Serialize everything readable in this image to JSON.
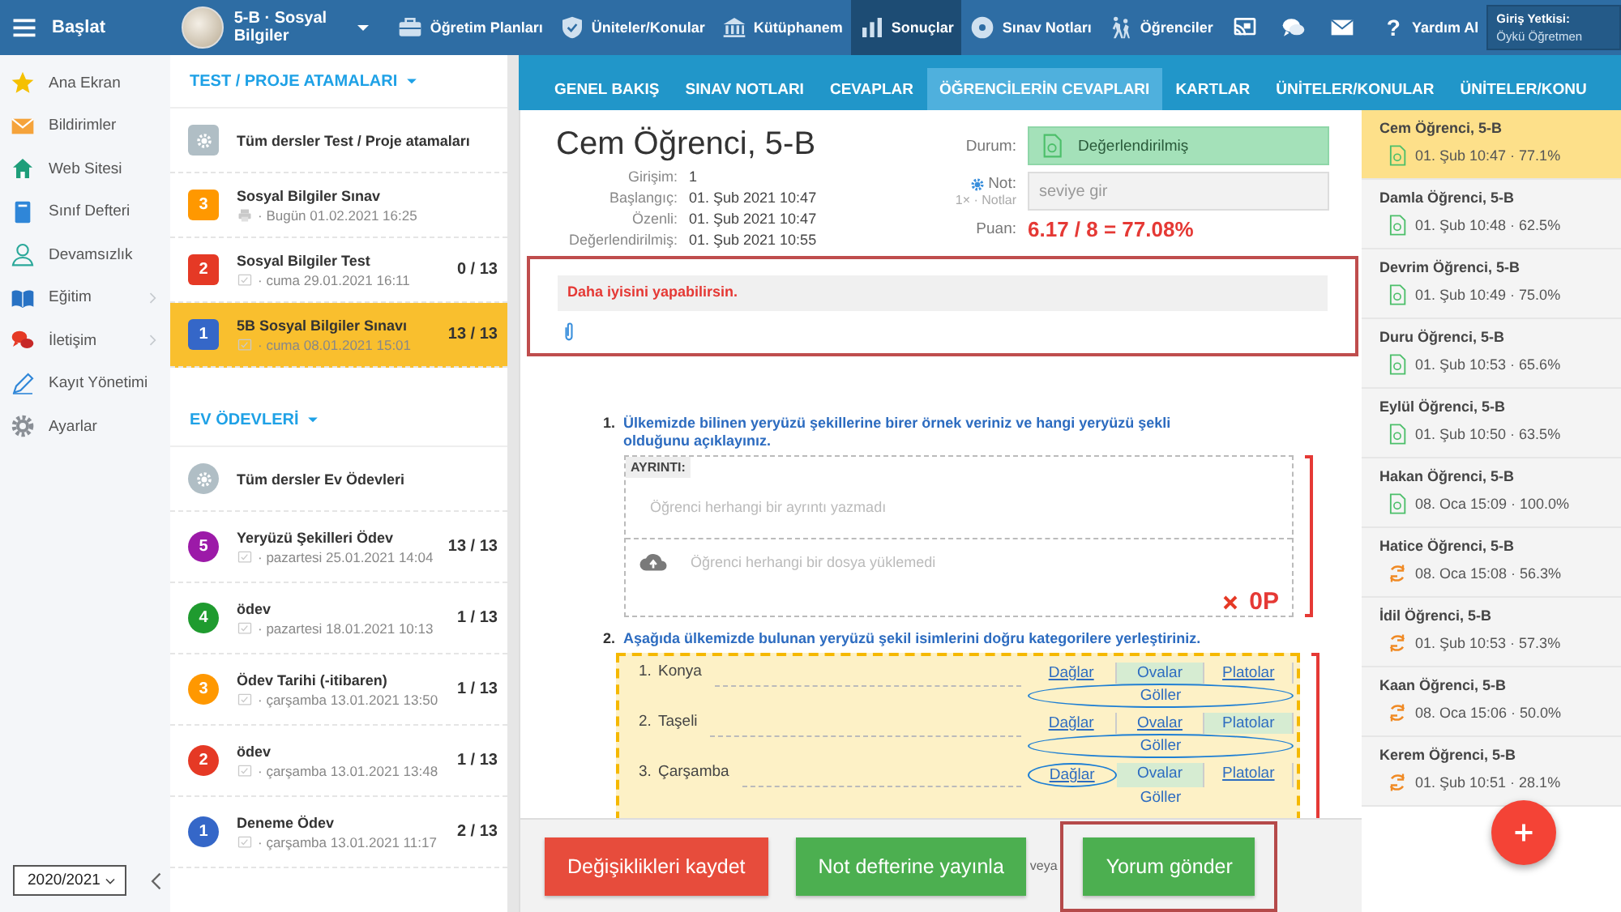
{
  "topbar": {
    "menu_label": "Başlat",
    "class_label": "5-B · Sosyal Bilgiler",
    "nav": [
      {
        "label": "Öğretim Planları",
        "kind": "briefcase",
        "selected": false
      },
      {
        "label": "Üniteler/Konular",
        "kind": "shield",
        "selected": false
      },
      {
        "label": "Kütüphanem",
        "kind": "bank",
        "selected": false
      },
      {
        "label": "Sonuçlar",
        "kind": "chart",
        "selected": true
      },
      {
        "label": "Sınav Notları",
        "kind": "disc",
        "selected": false
      },
      {
        "label": "Öğrenciler",
        "kind": "walkers",
        "selected": false
      }
    ],
    "help": {
      "glyph": "?",
      "label": "Yardım Al"
    },
    "login": {
      "label": "Giriş Yetkisi:",
      "user": "Öykü Öğretmen"
    }
  },
  "sidebar": {
    "items": [
      {
        "label": "Ana Ekran",
        "kind": "star",
        "expandable": false
      },
      {
        "label": "Bildirimler",
        "kind": "envelope",
        "expandable": false
      },
      {
        "label": "Web Sitesi",
        "kind": "house",
        "expandable": false
      },
      {
        "label": "Sınıf Defteri",
        "kind": "notebook",
        "expandable": false
      },
      {
        "label": "Devamsızlık",
        "kind": "person",
        "expandable": false
      },
      {
        "label": "Eğitim",
        "kind": "book",
        "expandable": true
      },
      {
        "label": "İletişim",
        "kind": "chat",
        "expandable": true
      },
      {
        "label": "Kayıt Yönetimi",
        "kind": "pen",
        "expandable": false
      },
      {
        "label": "Ayarlar",
        "kind": "gear",
        "expandable": false
      }
    ],
    "year": "2020/2021"
  },
  "assignments": {
    "sections": [
      {
        "title": "TEST / PROJE ATAMALARI",
        "kind": "square",
        "items": [
          {
            "kind": "all",
            "color": "#b0bec5",
            "title": "Tüm dersler Test / Proje atamaları",
            "selected": false
          },
          {
            "kind": "print",
            "badge": "3",
            "color": "#ff9800",
            "title": "Sosyal Bilgiler Sınav",
            "date": "· Bugün 01.02.2021 16:25",
            "selected": false
          },
          {
            "kind": "task",
            "badge": "2",
            "color": "#e53925",
            "title": "Sosyal Bilgiler Test",
            "date": "· cuma 29.01.2021 16:11",
            "count": "0 / 13",
            "selected": false
          },
          {
            "kind": "task",
            "badge": "1",
            "color": "#3567c8",
            "title": "5B Sosyal Bilgiler Sınavı",
            "date": "· cuma 08.01.2021 15:01",
            "count": "13 / 13",
            "selected": true
          }
        ]
      },
      {
        "title": "EV ÖDEVLERİ",
        "kind": "circle",
        "items": [
          {
            "kind": "all",
            "color": "#b0bec5",
            "title": "Tüm dersler Ev Ödevleri",
            "selected": false
          },
          {
            "kind": "task",
            "badge": "5",
            "color": "#9c1aa8",
            "title": "Yeryüzü Şekilleri Ödev",
            "date": "· pazartesi 25.01.2021 14:04",
            "count": "13 / 13",
            "selected": false
          },
          {
            "kind": "task",
            "badge": "4",
            "color": "#1f9b2f",
            "title": "ödev",
            "date": "· pazartesi 18.01.2021 10:13",
            "count": "1 / 13",
            "selected": false
          },
          {
            "kind": "task",
            "badge": "3",
            "color": "#ff9800",
            "title": "Ödev Tarihi (-itibaren)",
            "date": "· çarşamba 13.01.2021 13:50",
            "count": "1 / 13",
            "selected": false
          },
          {
            "kind": "task",
            "badge": "2",
            "color": "#e53925",
            "title": "ödev",
            "date": "· çarşamba 13.01.2021 13:48",
            "count": "1 / 13",
            "selected": false
          },
          {
            "kind": "task",
            "badge": "1",
            "color": "#3567c8",
            "title": "Deneme Ödev",
            "date": "· çarşamba 13.01.2021 11:17",
            "count": "2 / 13",
            "selected": false
          }
        ]
      }
    ]
  },
  "tabs": [
    {
      "label": "GENEL BAKIŞ",
      "selected": false
    },
    {
      "label": "SINAV NOTLARI",
      "selected": false
    },
    {
      "label": "CEVAPLAR",
      "selected": false
    },
    {
      "label": "ÖĞRENCİLERİN CEVAPLARI",
      "selected": true
    },
    {
      "label": "KARTLAR",
      "selected": false
    },
    {
      "label": "ÜNİTELER/KONULAR",
      "selected": false
    },
    {
      "label": "ÜNİTELER/KONU",
      "selected": false
    }
  ],
  "student": {
    "name": "Cem Öğrenci, 5-B",
    "info": [
      {
        "label": "Girişim:",
        "value": "1"
      },
      {
        "label": "Başlangıç:",
        "value": "01. Şub 2021 10:47"
      },
      {
        "label": "Özenli:",
        "value": "01. Şub 2021 10:47"
      },
      {
        "label": "Değerlendirilmiş:",
        "value": "01. Şub 2021 10:55"
      }
    ],
    "status_label": "Durum:",
    "status": "Değerlendirilmiş",
    "grade_label": "Not:",
    "grade_sub": "1× · Notlar",
    "grade_placeholder": "seviye gir",
    "score_label": "Puan:",
    "score": "6.17 / 8 = 77.08%"
  },
  "comment": {
    "value": "Daha iyisini yapabilirsin.",
    "highlighted": true
  },
  "questions": [
    {
      "kind": "text",
      "number": "1.",
      "prompt": "Ülkemizde bilinen yeryüzü şekillerine birer örnek veriniz ve hangi yeryüzü şekli olduğunu açıklayınız.",
      "detail_label": "AYRINTI:",
      "detail_text": "Öğrenci herhangi bir ayrıntı yazmadı",
      "upload_text": "Öğrenci herhangi bir dosya yüklemedi",
      "score": "0P",
      "correct": false
    },
    {
      "kind": "matching",
      "number": "2.",
      "prompt": "Aşağıda ülkemizde bulunan yeryüzü şekil isimlerini doğru kategorilere yerleştiriniz.",
      "rows": [
        {
          "number": "1.",
          "term": "Konya",
          "options": [
            {
              "label": "Dağlar",
              "correct": false,
              "picked": false
            },
            {
              "label": "Ovalar",
              "correct": true,
              "picked": false
            },
            {
              "label": "Platolar",
              "correct": false,
              "picked": false
            },
            {
              "label": "Göller",
              "correct": false,
              "picked": true
            }
          ]
        },
        {
          "number": "2.",
          "term": "Taşeli",
          "options": [
            {
              "label": "Dağlar",
              "correct": false,
              "picked": false
            },
            {
              "label": "Ovalar",
              "correct": false,
              "picked": false
            },
            {
              "label": "Platolar",
              "correct": true,
              "picked": false
            },
            {
              "label": "Göller",
              "correct": false,
              "picked": true
            }
          ]
        },
        {
          "number": "3.",
          "term": "Çarşamba",
          "options": [
            {
              "label": "Dağlar",
              "correct": false,
              "picked": true
            },
            {
              "label": "Ovalar",
              "correct": true,
              "picked": false
            },
            {
              "label": "Platolar",
              "correct": false,
              "picked": false
            },
            {
              "label": "Göller",
              "correct": false,
              "picked": false
            }
          ]
        }
      ]
    }
  ],
  "actions": {
    "save": "Değişiklikleri kaydet",
    "publish": "Not defterine yayınla",
    "or": "veya",
    "send": "Yorum gönder",
    "send_highlighted": true
  },
  "students": [
    {
      "name": "Cem Öğrenci, 5-B",
      "kind": "graded",
      "meta": "01. Şub 10:47 · 77.1%",
      "selected": true
    },
    {
      "name": "Damla Öğrenci, 5-B",
      "kind": "graded",
      "meta": "01. Şub 10:48 · 62.5%",
      "selected": false
    },
    {
      "name": "Devrim Öğrenci, 5-B",
      "kind": "graded",
      "meta": "01. Şub 10:49 · 75.0%",
      "selected": false
    },
    {
      "name": "Duru Öğrenci, 5-B",
      "kind": "graded",
      "meta": "01. Şub 10:53 · 65.6%",
      "selected": false
    },
    {
      "name": "Eylül Öğrenci, 5-B",
      "kind": "graded",
      "meta": "01. Şub 10:50 · 63.5%",
      "selected": false
    },
    {
      "name": "Hakan Öğrenci, 5-B",
      "kind": "graded",
      "meta": "08. Oca 15:09 · 100.0%",
      "selected": false
    },
    {
      "name": "Hatice Öğrenci, 5-B",
      "kind": "pending",
      "meta": "08. Oca 15:08 · 56.3%",
      "selected": false
    },
    {
      "name": "İdil Öğrenci, 5-B",
      "kind": "pending",
      "meta": "01. Şub 10:53 · 57.3%",
      "selected": false
    },
    {
      "name": "Kaan Öğrenci, 5-B",
      "kind": "pending",
      "meta": "08. Oca 15:06 · 50.0%",
      "selected": false
    },
    {
      "name": "Kerem Öğrenci, 5-B",
      "kind": "pending",
      "meta": "01. Şub 10:51 · 28.1%",
      "selected": false
    }
  ]
}
